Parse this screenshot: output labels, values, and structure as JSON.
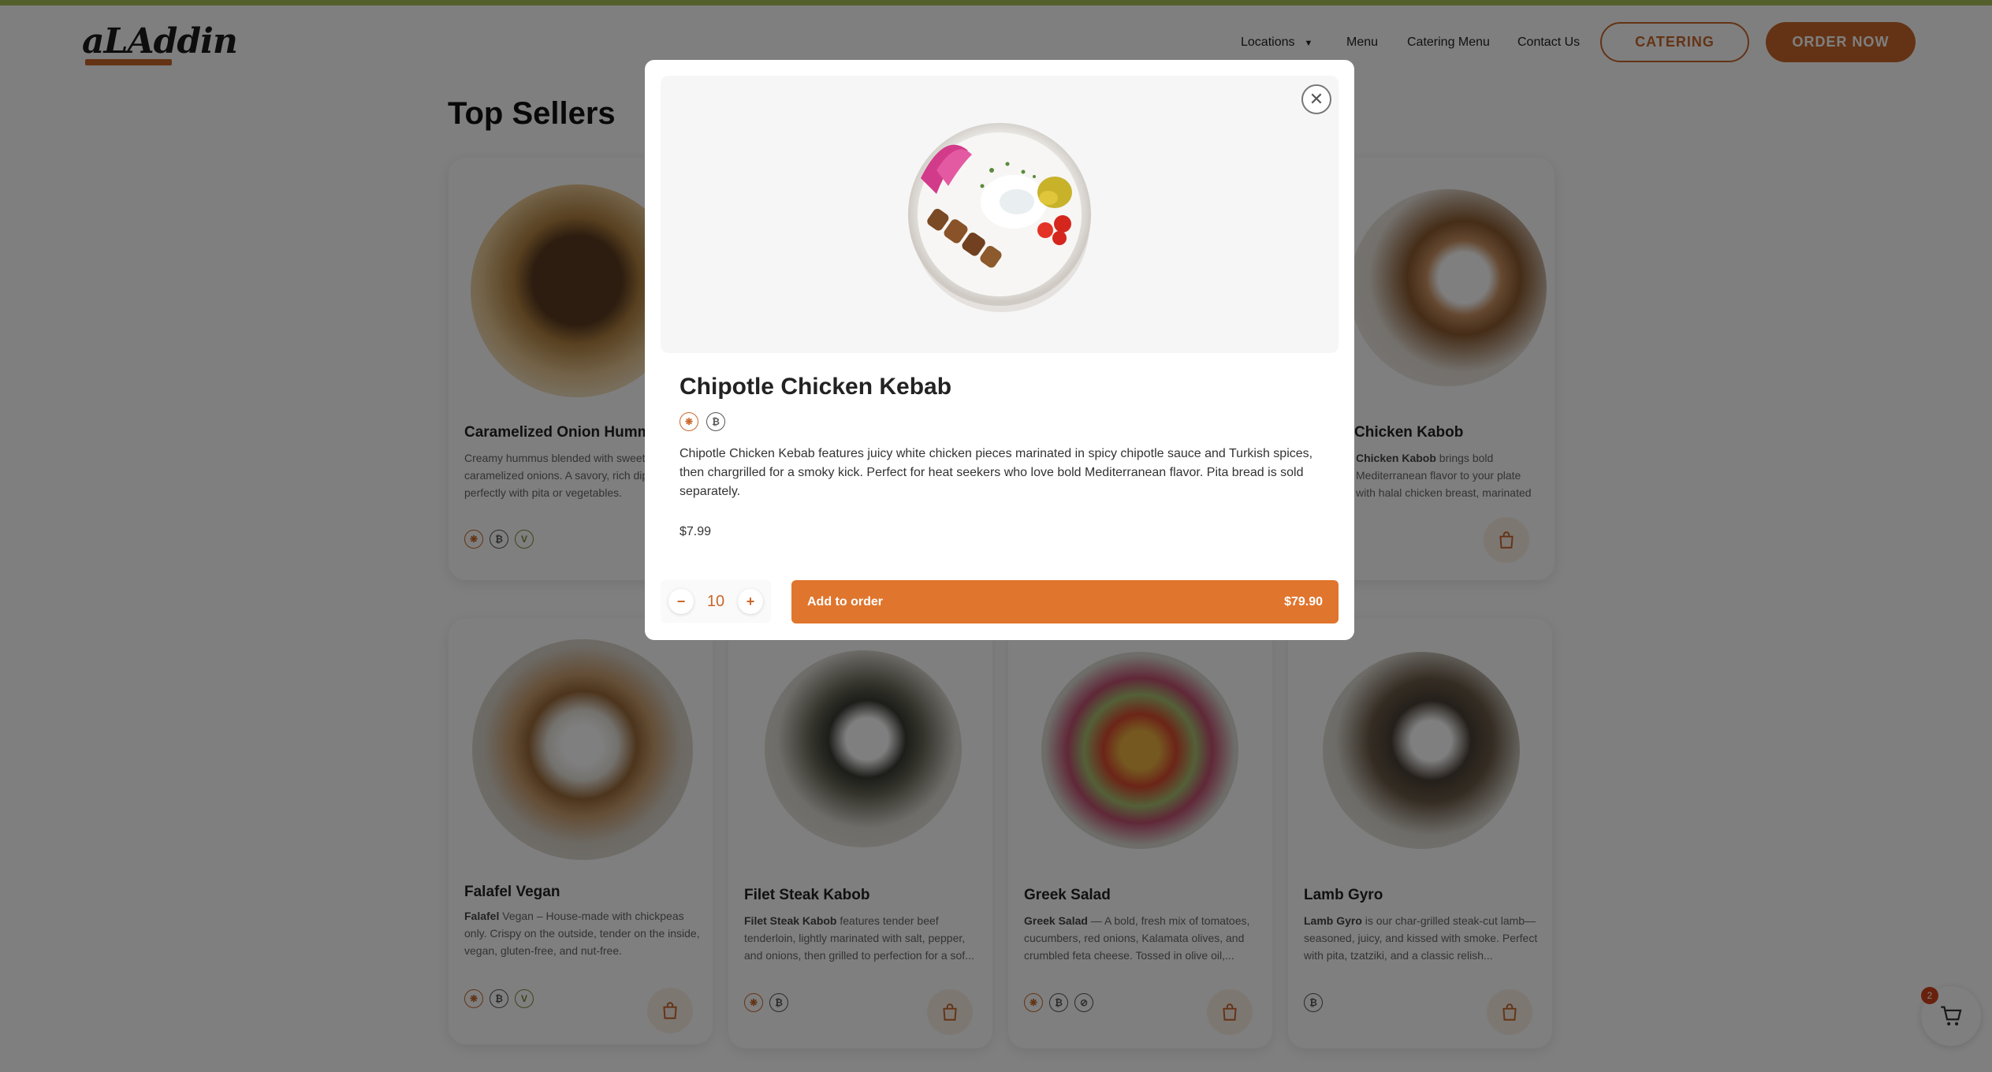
{
  "header": {
    "logo_text": "aLAddin",
    "nav": {
      "locations": "Locations",
      "menu": "Menu",
      "catering_menu": "Catering Menu",
      "contact": "Contact Us"
    },
    "catering_button": "CATERING",
    "order_button": "ORDER NOW"
  },
  "section_title": "Top Sellers",
  "cards": [
    {
      "title": "Caramelized Onion Hummus",
      "desc": "Creamy hummus blended with sweet caramelized onions. A savory, rich dip that pairs perfectly with pita or vegetables.",
      "tags": [
        "spicy-icon",
        "gluten-icon",
        "vegan-icon"
      ]
    },
    {
      "title": "Chicken Kabob",
      "desc_bold": "Chicken Kabob",
      "desc": " brings bold Mediterranean flavor to your plate with halal chicken breast, marinated in garlic, lemon, an...",
      "tags": [
        "gluten-icon"
      ]
    },
    {
      "title": "Falafel Vegan",
      "desc_bold": "Falafel",
      "desc": " Vegan – House-made with chickpeas only. Crispy on the outside, tender on the inside, vegan, gluten-free, and nut-free.",
      "tags": [
        "spicy-icon",
        "gluten-icon",
        "vegan-icon"
      ]
    },
    {
      "title": "Filet Steak Kabob",
      "desc_bold": "Filet Steak Kabob",
      "desc": " features tender beef tenderloin, lightly marinated with salt, pepper, and onions, then grilled to perfection for a sof...",
      "tags": [
        "spicy-icon",
        "gluten-icon"
      ]
    },
    {
      "title": "Greek Salad",
      "desc_bold": "Greek Salad",
      "desc": " — A bold, fresh mix of tomatoes, cucumbers, red onions, Kalamata olives, and crumbled feta cheese. Tossed in olive oil,...",
      "tags": [
        "spicy-icon",
        "gluten-icon",
        "nut-free-icon"
      ]
    },
    {
      "title": "Lamb Gyro",
      "desc_bold": "Lamb Gyro",
      "desc": " is our char-grilled steak-cut lamb—seasoned, juicy, and kissed with smoke. Perfect with pita, tzatziki, and a classic relish...",
      "tags": [
        "gluten-icon"
      ]
    }
  ],
  "modal": {
    "title": "Chipotle Chicken Kebab",
    "tags": [
      "spicy-icon",
      "gluten-icon"
    ],
    "description": "Chipotle Chicken Kebab features juicy white chicken pieces marinated in spicy chipotle sauce and Turkish spices, then chargrilled for a smoky kick. Perfect for heat seekers who love bold Mediterranean flavor. Pita bread is sold separately.",
    "price": "$7.99",
    "quantity": "10",
    "add_label": "Add to order",
    "total": "$79.90"
  },
  "cart": {
    "count": "2"
  },
  "colors": {
    "accent": "#c9672a",
    "add_button": "#e0752d",
    "top_stripe": "#a6c05a"
  }
}
